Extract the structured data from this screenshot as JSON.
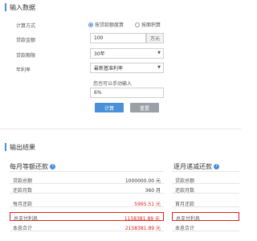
{
  "input_section": {
    "title": "输入数据",
    "calc_method_label": "计算方式",
    "radio_options": [
      "按贷款额度算",
      "按面积算"
    ],
    "loan_amount_label": "贷款金额",
    "loan_amount_value": "100",
    "loan_amount_unit": "万元",
    "loan_term_label": "贷款期限",
    "loan_term_value": "30年",
    "rate_label": "年利率",
    "rate_value": "最新基准利率",
    "manual_hint": "您也可以手动输入",
    "manual_rate_value": "6%",
    "calc_button": "计算",
    "reset_button": "重置"
  },
  "output_section": {
    "title": "输出结果",
    "equal_payment": {
      "title": "每月等额还款",
      "rows": [
        {
          "label": "贷款总额",
          "value": "1000000.00 元"
        },
        {
          "label": "还款月数",
          "value": "360 月"
        },
        {
          "label": "每月还款",
          "value": "5995.51 元"
        },
        {
          "label": "总支付利息",
          "value": "1158381.89 元"
        },
        {
          "label": "本息合计",
          "value": "2158381.89 元"
        }
      ]
    },
    "decreasing_payment": {
      "title": "逐月递减还款",
      "rows": [
        {
          "label": "贷款总额"
        },
        {
          "label": "还款月数"
        },
        {
          "label": "首月还款"
        },
        {
          "label": "总支付利息"
        },
        {
          "label": "本息合计"
        }
      ]
    }
  },
  "colors": {
    "accent": "#4a90d9",
    "highlight": "#e02020",
    "reset": "#9aa0a6"
  },
  "icons": [
    "question-icon",
    "chevron-down-icon"
  ]
}
